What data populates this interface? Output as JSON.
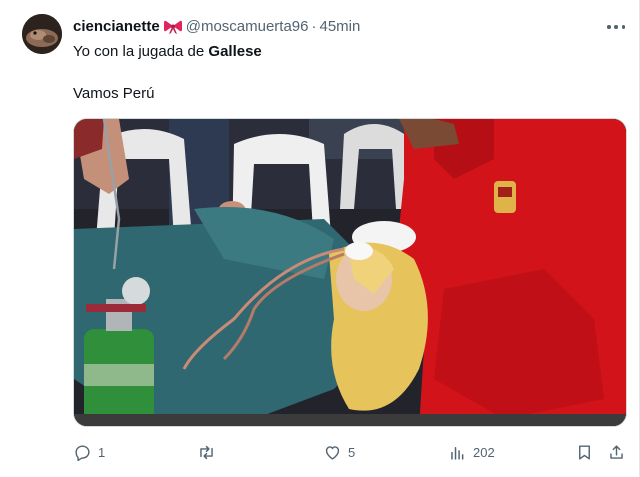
{
  "tweet": {
    "display_name": "ciencianette",
    "emoji": "bow",
    "handle": "@moscamuerta96",
    "separator": "·",
    "time": "45min",
    "text_line1_prefix": "Yo con la jugada de ",
    "text_line1_bold": "Gallese",
    "text_line2": "Vamos Perú"
  },
  "actions": {
    "reply_count": "1",
    "retweet_count": "",
    "like_count": "5",
    "views_count": "202"
  },
  "icons": [
    "more-icon",
    "reply-icon",
    "retweet-icon",
    "like-icon",
    "views-icon",
    "bookmark-icon",
    "share-icon"
  ],
  "colors": {
    "text": "#0f1419",
    "secondary": "#536471",
    "border": "#cfd9de"
  }
}
